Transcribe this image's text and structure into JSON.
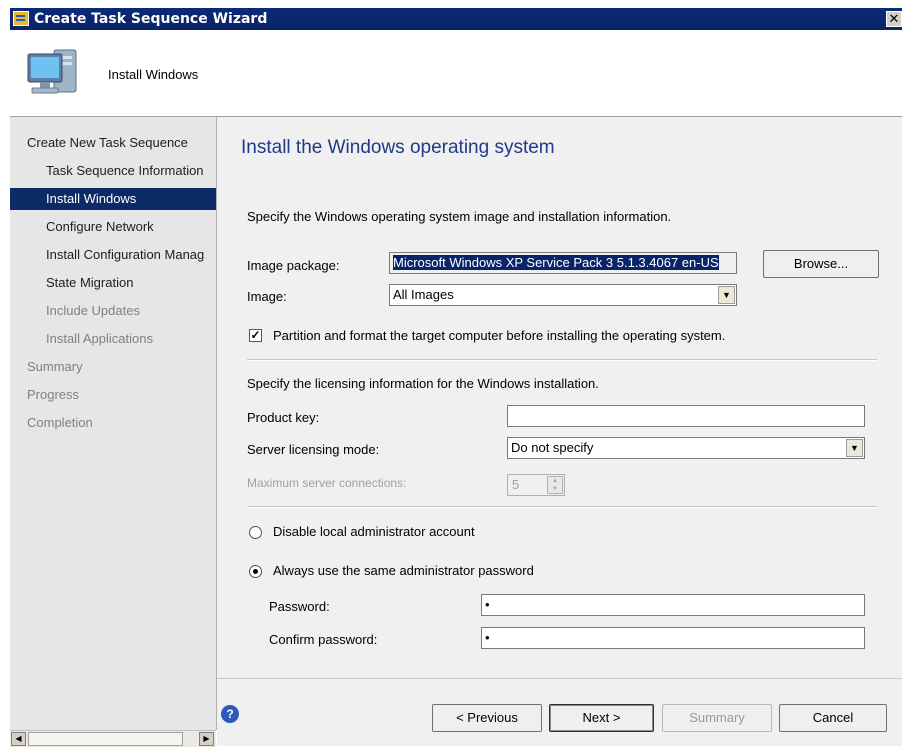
{
  "window": {
    "title": "Create Task Sequence Wizard",
    "close_glyph": "✕"
  },
  "header": {
    "step_name": "Install Windows"
  },
  "sidebar": {
    "items": [
      {
        "label": "Create New Task Sequence",
        "state": "normal"
      },
      {
        "label": "Task Sequence Information",
        "state": "normal"
      },
      {
        "label": "Install Windows",
        "state": "selected"
      },
      {
        "label": "Configure Network",
        "state": "normal"
      },
      {
        "label": "Install Configuration Manag",
        "state": "normal"
      },
      {
        "label": "State Migration",
        "state": "normal"
      },
      {
        "label": "Include Updates",
        "state": "dim"
      },
      {
        "label": "Install Applications",
        "state": "dim"
      },
      {
        "label": "Summary",
        "state": "dim"
      },
      {
        "label": "Progress",
        "state": "dim"
      },
      {
        "label": "Completion",
        "state": "dim"
      }
    ]
  },
  "main": {
    "title": "Install the Windows operating system",
    "intro": "Specify the Windows operating system image and installation information.",
    "image_package_label": "Image package:",
    "image_package_value": "Microsoft Windows XP Service Pack 3 5.1.3.4067 en-US",
    "browse_label": "Browse...",
    "image_label": "Image:",
    "image_value": "All Images",
    "partition_label": "Partition and format the target computer before installing the operating system.",
    "partition_checked": true,
    "licensing_intro": "Specify the licensing information for the Windows installation.",
    "product_key_label": "Product key:",
    "product_key_value": "",
    "server_mode_label": "Server licensing mode:",
    "server_mode_value": "Do not specify",
    "max_connections_label": "Maximum server connections:",
    "max_connections_value": "5",
    "disable_admin_label": "Disable local administrator account",
    "always_same_label": "Always use the same administrator password",
    "selected_admin_option": "always_same",
    "password_label": "Password:",
    "password_value": "•",
    "confirm_label": "Confirm password:",
    "confirm_value": "•"
  },
  "footer": {
    "previous_label": "< Previous",
    "next_label": "Next >",
    "summary_label": "Summary",
    "cancel_label": "Cancel",
    "help_glyph": "?"
  },
  "colors": {
    "titlebar": "#0b2a78",
    "selection": "#0b2a66",
    "title_text": "#1f3a8a"
  }
}
